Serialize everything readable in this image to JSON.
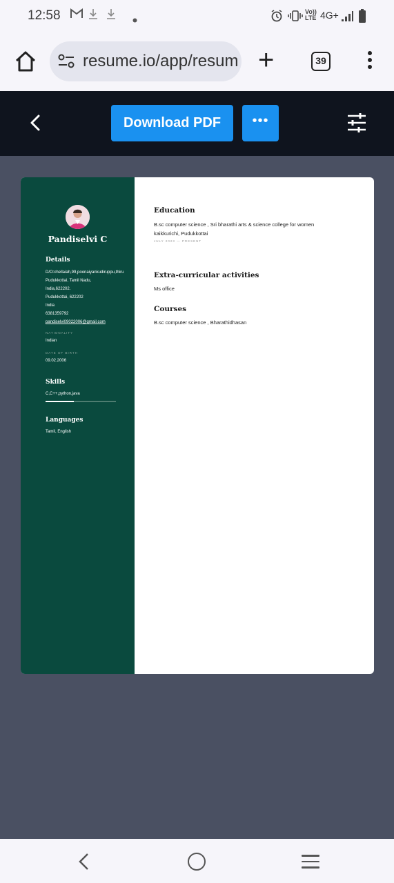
{
  "status": {
    "time": "12:58",
    "network": "4G+"
  },
  "browser": {
    "url": "resume.io/app/resum",
    "tab_count": "39"
  },
  "toolbar": {
    "download_label": "Download PDF",
    "more_label": "•••"
  },
  "resume": {
    "name": "Pandiselvi C",
    "details": {
      "heading": "Details",
      "lines": [
        "D/O:chellaiah,99,poonaiyankudiruppu,thiru",
        "Pudukkottai, Tamil Nadu,",
        "India,622202.",
        "Pudukkottai, 622202",
        "India",
        "6381359792",
        "pandiselvi09022006@gmail.com"
      ],
      "nationality_label": "NATIONALITY",
      "nationality": "Indian",
      "dob_label": "DATE OF BIRTH",
      "dob": "09.02.2006"
    },
    "skills": {
      "heading": "Skills",
      "text": "C,C++,python,java",
      "level": 0.4
    },
    "languages": {
      "heading": "Languages",
      "text": "Tamil, English"
    },
    "education": {
      "heading": "Education",
      "line1": "B.sc computer science , Sri bharathi arts & science college for women",
      "line2": "kaikkurichi, Pudukkottai",
      "dates": "JULY 2023 — PRESENT"
    },
    "extra": {
      "heading": "Extra-curricular activities",
      "text": "Ms office"
    },
    "courses": {
      "heading": "Courses",
      "text": "B.sc computer science , Bharathidhasan"
    }
  }
}
